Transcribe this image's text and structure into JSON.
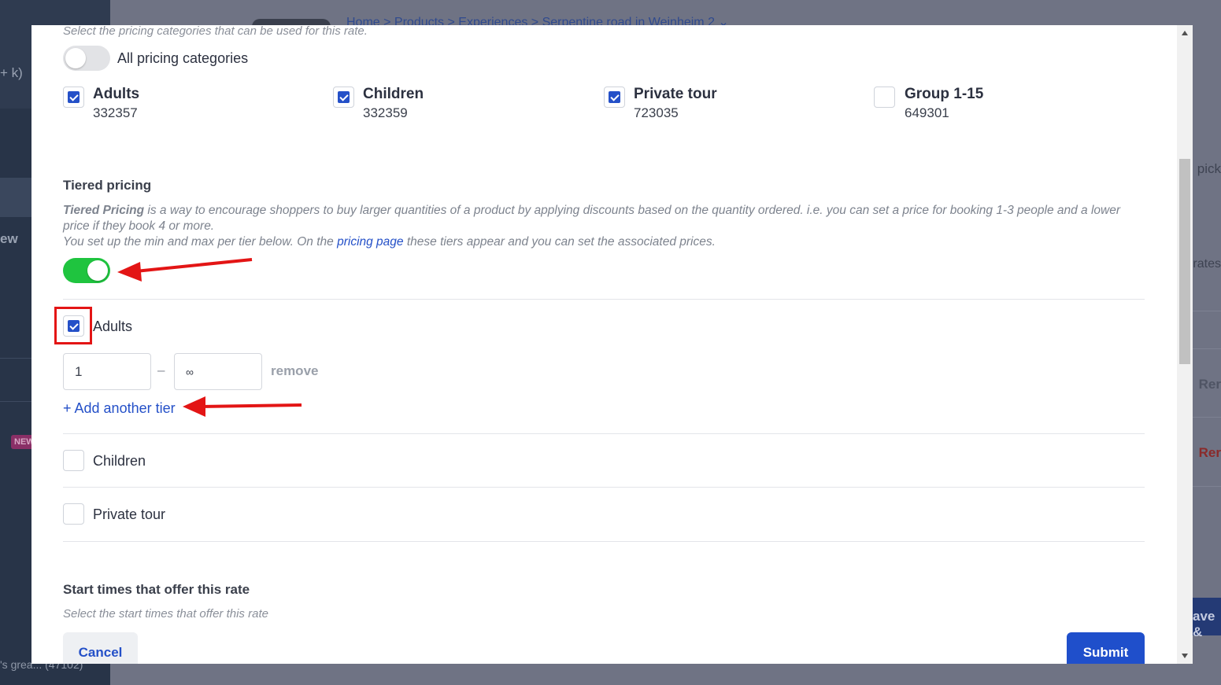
{
  "background": {
    "sidebar": {
      "shortcut_text": "+ k)",
      "item_fragment": "ew",
      "new_badge": "NEW",
      "bottom_text": "'s grea... (47102)"
    },
    "breadcrumb": "Home  >  Products  >  Experiences  >  Serpentine road in Weinheim 2 ⌄",
    "right_fragments": {
      "pick": "pick",
      "rates": "rates",
      "rem1": "Rer",
      "rem2": "Rer",
      "save": "ave &"
    }
  },
  "modal": {
    "top_hint": "Select the pricing categories that can be used for this rate.",
    "all_categories": {
      "label": "All pricing categories",
      "enabled": false
    },
    "categories": [
      {
        "name": "Adults",
        "id": "332357",
        "checked": true
      },
      {
        "name": "Children",
        "id": "332359",
        "checked": true
      },
      {
        "name": "Private tour",
        "id": "723035",
        "checked": true
      },
      {
        "name": "Group 1-15",
        "id": "649301",
        "checked": false
      }
    ],
    "tiered": {
      "title": "Tiered pricing",
      "desc_bold": "Tiered Pricing",
      "desc_line1": " is a way to encourage shoppers to buy larger quantities of a product by applying discounts based on the quantity ordered. i.e. you can set a price for booking 1-3 people and a lower price if they book 4 or more.",
      "desc_line2_a": "You set up the min and max per tier below. On the ",
      "desc_link": "pricing page",
      "desc_line2_b": " these tiers appear and you can set the associated prices.",
      "enabled": true
    },
    "tier_groups": [
      {
        "name": "Adults",
        "checked": true
      },
      {
        "name": "Children",
        "checked": false
      },
      {
        "name": "Private tour",
        "checked": false
      }
    ],
    "tier_row": {
      "min": "1",
      "dash": "–",
      "max": "∞",
      "remove": "remove"
    },
    "add_tier": "+ Add another tier",
    "start_times": {
      "title": "Start times that offer this rate",
      "hint": "Select the start times that offer this rate"
    },
    "buttons": {
      "cancel": "Cancel",
      "submit": "Submit"
    }
  },
  "colors": {
    "accent": "#2450c8",
    "toggle_on": "#1fc43f",
    "annotation": "#e31515"
  }
}
